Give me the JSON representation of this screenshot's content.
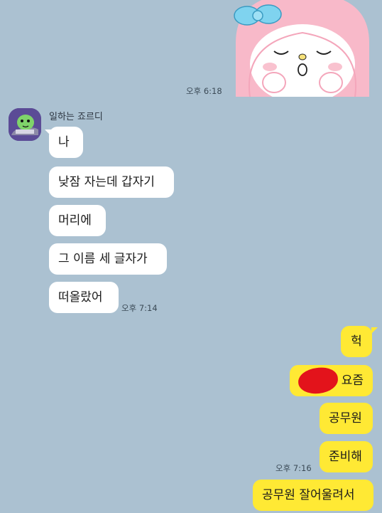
{
  "chat": {
    "timestamps": {
      "sticker_time": "오후 6:18",
      "incoming_time": "오후 7:14",
      "outgoing_time": "오후 7:16"
    },
    "sender": {
      "name": "일하는 죠르디"
    },
    "incoming_messages": [
      "나",
      "낮잠 자는데 갑자기",
      "머리에",
      "그 이름 세 글자가",
      "떠올랐어"
    ],
    "outgoing_messages": [
      "헉",
      "요즘",
      "공무원",
      "준비해",
      "공무원 잘어울려서"
    ],
    "colors": {
      "background": "#abc1d1",
      "incoming_bubble": "#ffffff",
      "outgoing_bubble": "#ffe934",
      "redaction": "#e3131b"
    },
    "icons": {
      "sticker": "my-melody-sticker",
      "avatar": "jordy-avatar"
    }
  }
}
